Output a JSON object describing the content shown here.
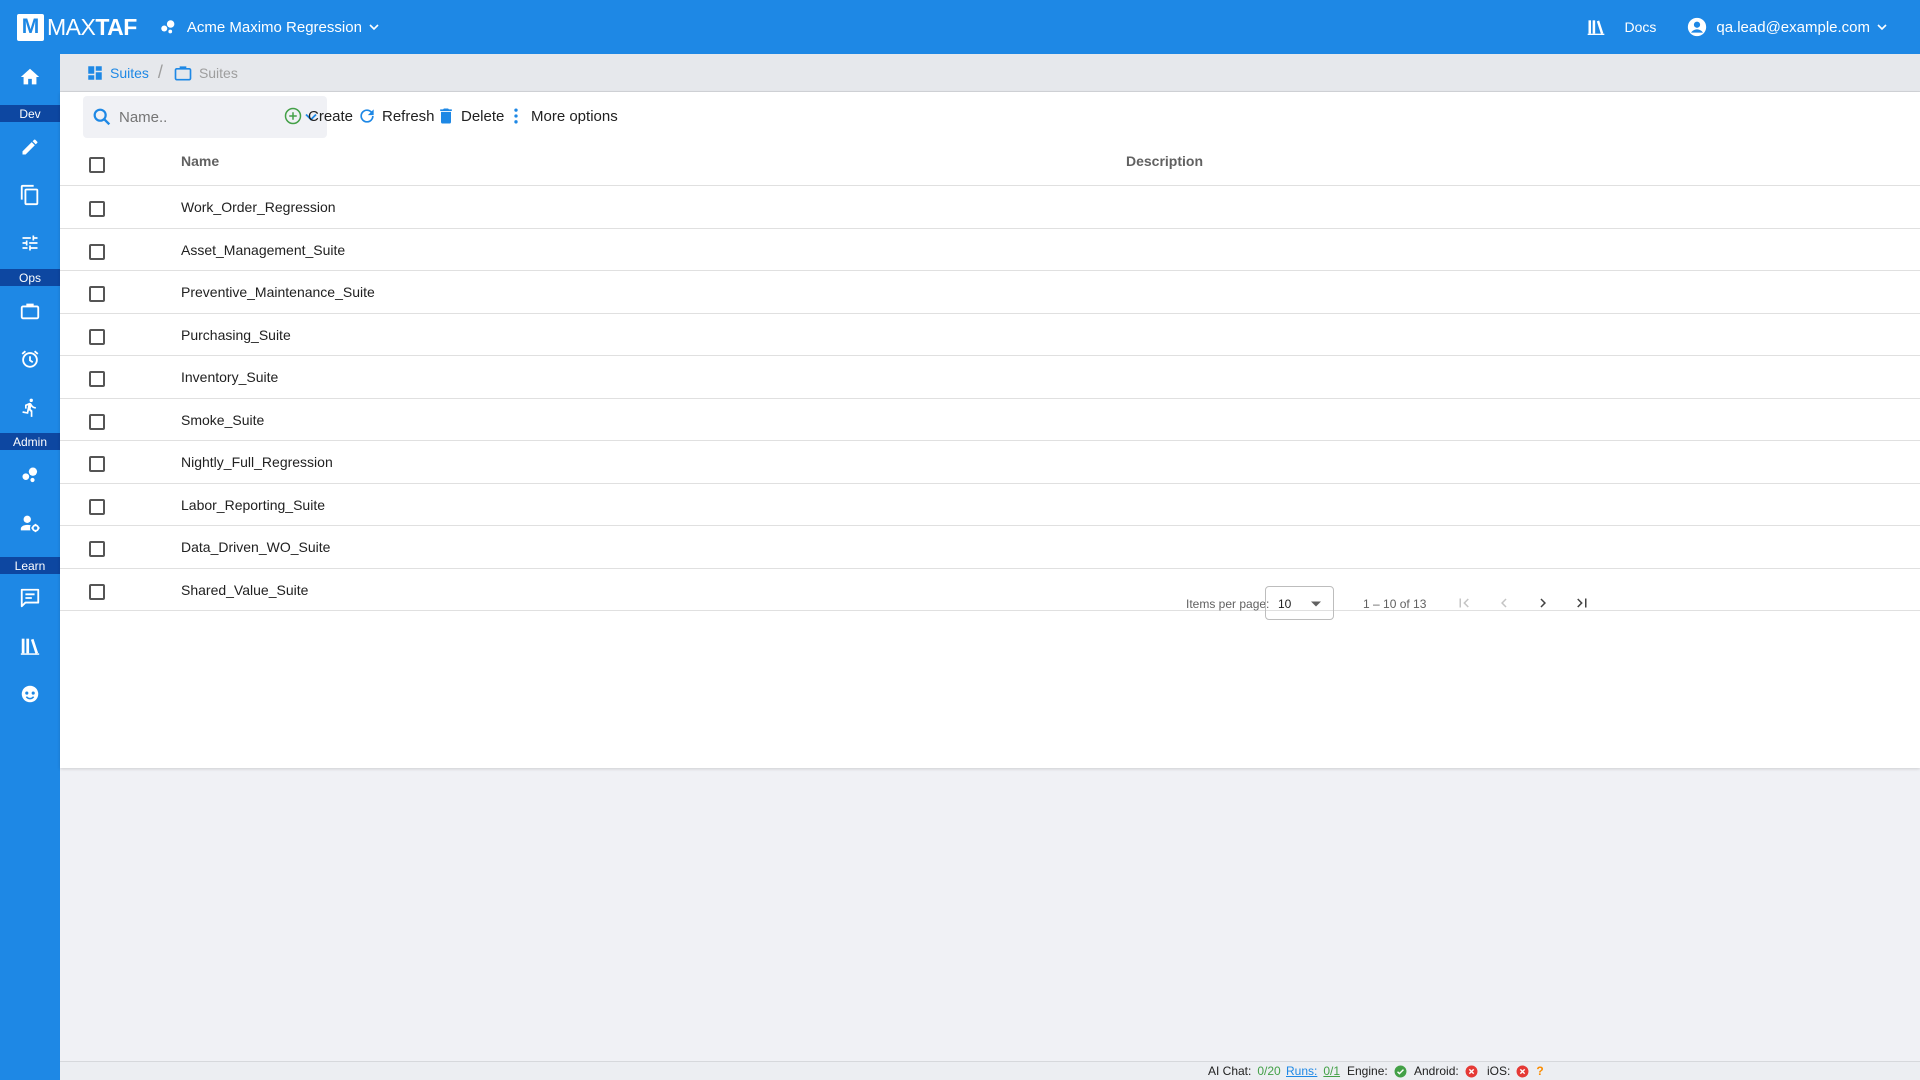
{
  "topbar": {
    "logo_letter": "M",
    "logo_light": "MAX",
    "logo_bold": "TAF",
    "project_name": "Acme Maximo Regression",
    "docs_label": "Docs",
    "user_email": "qa.lead@example.com"
  },
  "sidebar": {
    "sections": [
      "Dev",
      "Ops",
      "Admin",
      "Learn"
    ],
    "icons": [
      "home-icon",
      "pencil-icon",
      "copy-icon",
      "tune-icon",
      "briefcase-icon",
      "alarm-icon",
      "run-icon",
      "bubbles-icon",
      "user-settings-icon",
      "chat-icon",
      "library-icon",
      "support-icon"
    ]
  },
  "breadcrumb": {
    "root_label": "Suites",
    "current_label": "Suites"
  },
  "toolbar": {
    "search_placeholder": "Name..",
    "create_label": "Create",
    "refresh_label": "Refresh",
    "delete_label": "Delete",
    "more_label": "More options"
  },
  "table": {
    "columns": [
      "Name",
      "Description"
    ],
    "rows": [
      {
        "name": "Work_Order_Regression",
        "description": ""
      },
      {
        "name": "Asset_Management_Suite",
        "description": ""
      },
      {
        "name": "Preventive_Maintenance_Suite",
        "description": ""
      },
      {
        "name": "Purchasing_Suite",
        "description": ""
      },
      {
        "name": "Inventory_Suite",
        "description": ""
      },
      {
        "name": "Smoke_Suite",
        "description": ""
      },
      {
        "name": "Nightly_Full_Regression",
        "description": ""
      },
      {
        "name": "Labor_Reporting_Suite",
        "description": ""
      },
      {
        "name": "Data_Driven_WO_Suite",
        "description": ""
      },
      {
        "name": "Shared_Value_Suite",
        "description": ""
      }
    ]
  },
  "paginator": {
    "items_per_page_label": "Items per page:",
    "page_size": "10",
    "range_label": "1 – 10 of 13"
  },
  "statusbar": {
    "ai_chat_label": "AI Chat:",
    "ai_chat_value": "0/20",
    "runs_label": "Runs:",
    "runs_value": "0/1",
    "engine_label": "Engine:",
    "android_label": "Android:",
    "ios_label": "iOS:",
    "help_symbol": "?"
  },
  "colors": {
    "brand_blue": "#1e88e5",
    "section_dark_blue": "#0d47a1",
    "ok_green": "#43a047",
    "error_red": "#e53935",
    "help_orange": "#fb8c00"
  }
}
